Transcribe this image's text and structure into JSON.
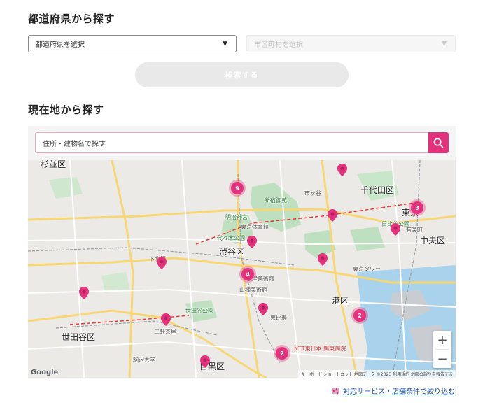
{
  "prefecture_section": {
    "title": "都道府県から探す",
    "prefecture_select": "都道府県を選択",
    "city_select": "市区町村を選択",
    "search_button": "検索する"
  },
  "location_section": {
    "title": "現在地から探す",
    "address_placeholder": "住所・建物名で探す"
  },
  "map": {
    "labels": {
      "suginami": "杉並区",
      "chiyoda": "千代田区",
      "tokyo": "東京",
      "chuo": "中央区",
      "shibuya": "渋谷区",
      "minato": "港区",
      "setagaya": "世田谷区",
      "meguro": "目黒区"
    },
    "small_labels": {
      "ichigaya": "市ヶ谷",
      "shinjuku_gyoen": "新宿御苑",
      "yoyogi_park": "代々木公園",
      "tokyo_tower": "東京タワー",
      "ebisu": "恵比寿",
      "sangenjaya": "三軒茶屋",
      "shimokita": "下北沢",
      "nezu": "根津美術館",
      "yamatane": "山種美術館",
      "ntt": "NTT東日本 関東病院",
      "meiji": "明治神宮",
      "hibiya": "日比谷公園",
      "yurakucho": "有楽町",
      "tokyo_gym": "東京体育館",
      "setagaya_park": "世田谷公園",
      "komazawa": "駒沢大学"
    },
    "clusters": [
      "9",
      "3",
      "4",
      "2",
      "2"
    ],
    "zoom_in": "+",
    "zoom_out": "−",
    "google": "Google",
    "attribution": "キーボード ショートカット  地図データ ©2023  利用規約  地図の誤りを報告する"
  },
  "filter_link": "対応サービス・店舗条件で絞り込む",
  "colors": {
    "accent": "#e3317b",
    "link": "#1a4fb3"
  }
}
